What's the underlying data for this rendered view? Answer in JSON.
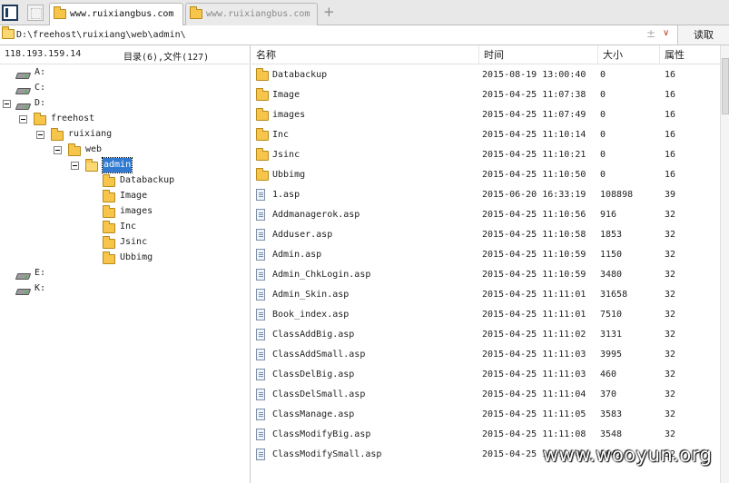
{
  "tabs": [
    {
      "label": "www.ruixiangbus.com",
      "active": true
    },
    {
      "label": "www.ruixiangbus.com",
      "active": false
    }
  ],
  "new_tab_symbol": "+",
  "pathbar": {
    "path": "D:\\freehost\\ruixiang\\web\\admin\\",
    "plusminus": "±",
    "dropdown": "∨",
    "read_button": "读取"
  },
  "left": {
    "ip": "118.193.159.14",
    "counts": "目录(6),文件(127)"
  },
  "tree": [
    {
      "label": "A:",
      "type": "drive"
    },
    {
      "label": "C:",
      "type": "drive"
    },
    {
      "label": "D:",
      "type": "drive"
    },
    {
      "label": "freehost",
      "type": "folder"
    },
    {
      "label": "ruixiang",
      "type": "folder"
    },
    {
      "label": "web",
      "type": "folder"
    },
    {
      "label": "admin",
      "type": "folder",
      "selected": true
    },
    {
      "label": "Databackup",
      "type": "folder"
    },
    {
      "label": "Image",
      "type": "folder"
    },
    {
      "label": "images",
      "type": "folder"
    },
    {
      "label": "Inc",
      "type": "folder"
    },
    {
      "label": "Jsinc",
      "type": "folder"
    },
    {
      "label": "Ubbimg",
      "type": "folder"
    },
    {
      "label": "E:",
      "type": "drive"
    },
    {
      "label": "K:",
      "type": "drive"
    }
  ],
  "columns": {
    "name": "名称",
    "time": "时间",
    "size": "大小",
    "attr": "属性"
  },
  "files": [
    {
      "name": "Databackup",
      "time": "2015-08-19 13:00:40",
      "size": "0",
      "attr": "16",
      "type": "folder"
    },
    {
      "name": "Image",
      "time": "2015-04-25 11:07:38",
      "size": "0",
      "attr": "16",
      "type": "folder"
    },
    {
      "name": "images",
      "time": "2015-04-25 11:07:49",
      "size": "0",
      "attr": "16",
      "type": "folder"
    },
    {
      "name": "Inc",
      "time": "2015-04-25 11:10:14",
      "size": "0",
      "attr": "16",
      "type": "folder"
    },
    {
      "name": "Jsinc",
      "time": "2015-04-25 11:10:21",
      "size": "0",
      "attr": "16",
      "type": "folder"
    },
    {
      "name": "Ubbimg",
      "time": "2015-04-25 11:10:50",
      "size": "0",
      "attr": "16",
      "type": "folder"
    },
    {
      "name": "1.asp",
      "time": "2015-06-20 16:33:19",
      "size": "108898",
      "attr": "39",
      "type": "file"
    },
    {
      "name": "Addmanagerok.asp",
      "time": "2015-04-25 11:10:56",
      "size": "916",
      "attr": "32",
      "type": "file"
    },
    {
      "name": "Adduser.asp",
      "time": "2015-04-25 11:10:58",
      "size": "1853",
      "attr": "32",
      "type": "file"
    },
    {
      "name": "Admin.asp",
      "time": "2015-04-25 11:10:59",
      "size": "1150",
      "attr": "32",
      "type": "file"
    },
    {
      "name": "Admin_ChkLogin.asp",
      "time": "2015-04-25 11:10:59",
      "size": "3480",
      "attr": "32",
      "type": "file"
    },
    {
      "name": "Admin_Skin.asp",
      "time": "2015-04-25 11:11:01",
      "size": "31658",
      "attr": "32",
      "type": "file"
    },
    {
      "name": "Book_index.asp",
      "time": "2015-04-25 11:11:01",
      "size": "7510",
      "attr": "32",
      "type": "file"
    },
    {
      "name": "ClassAddBig.asp",
      "time": "2015-04-25 11:11:02",
      "size": "3131",
      "attr": "32",
      "type": "file"
    },
    {
      "name": "ClassAddSmall.asp",
      "time": "2015-04-25 11:11:03",
      "size": "3995",
      "attr": "32",
      "type": "file"
    },
    {
      "name": "ClassDelBig.asp",
      "time": "2015-04-25 11:11:03",
      "size": "460",
      "attr": "32",
      "type": "file"
    },
    {
      "name": "ClassDelSmall.asp",
      "time": "2015-04-25 11:11:04",
      "size": "370",
      "attr": "32",
      "type": "file"
    },
    {
      "name": "ClassManage.asp",
      "time": "2015-04-25 11:11:05",
      "size": "3583",
      "attr": "32",
      "type": "file"
    },
    {
      "name": "ClassModifyBig.asp",
      "time": "2015-04-25 11:11:08",
      "size": "3548",
      "attr": "32",
      "type": "file"
    },
    {
      "name": "ClassModifySmall.asp",
      "time": "2015-04-25 11:11:09",
      "size": "3941",
      "attr": "32",
      "type": "file"
    }
  ],
  "watermark": "www.wooyun.org",
  "colors": {
    "selection": "#2f79d0",
    "folder": "#f6c54a",
    "accent": "#c0392b"
  }
}
